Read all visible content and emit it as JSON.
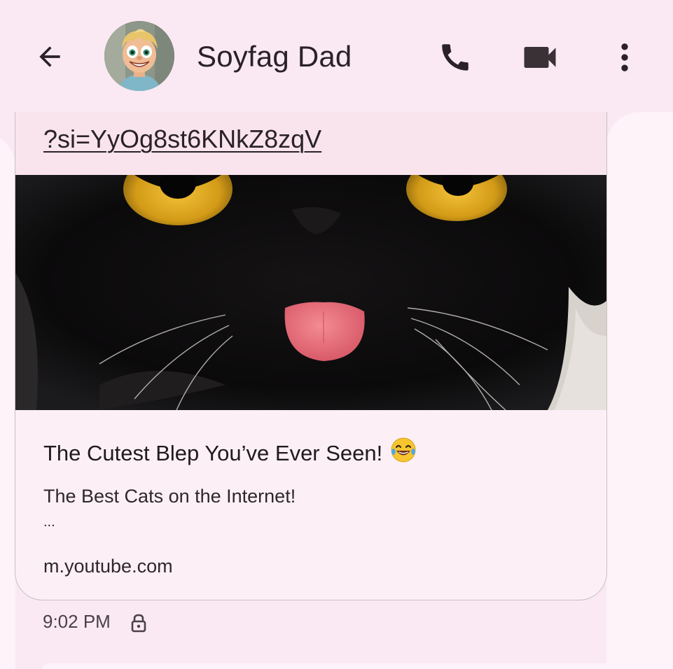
{
  "header": {
    "back_icon": "arrow-back-icon",
    "contact_name": "Soyfag Dad",
    "avatar_icon": "cartoon-avatar",
    "call_icon": "phone-icon",
    "video_icon": "videocam-icon",
    "more_icon": "more-vert-icon"
  },
  "message": {
    "link_text": "?si=YyOg8st6KNkZ8zqV",
    "preview": {
      "image": "black-cat-blep-thumbnail",
      "title": "The Cutest Blep You’ve Ever Seen!",
      "title_emoji": "face-with-tears-of-joy",
      "description": "The Best Cats on the Internet!",
      "ellipsis": "...",
      "domain": "m.youtube.com"
    },
    "timestamp": "9:02 PM",
    "encryption_icon": "lock-icon"
  },
  "colors": {
    "background": "#fae9f2",
    "bubble": "#fcf0f6",
    "link_strip": "#f9e4ee",
    "text": "#2a2226",
    "cat_eye": "#d6a31c",
    "cat_tongue": "#e9717b"
  }
}
